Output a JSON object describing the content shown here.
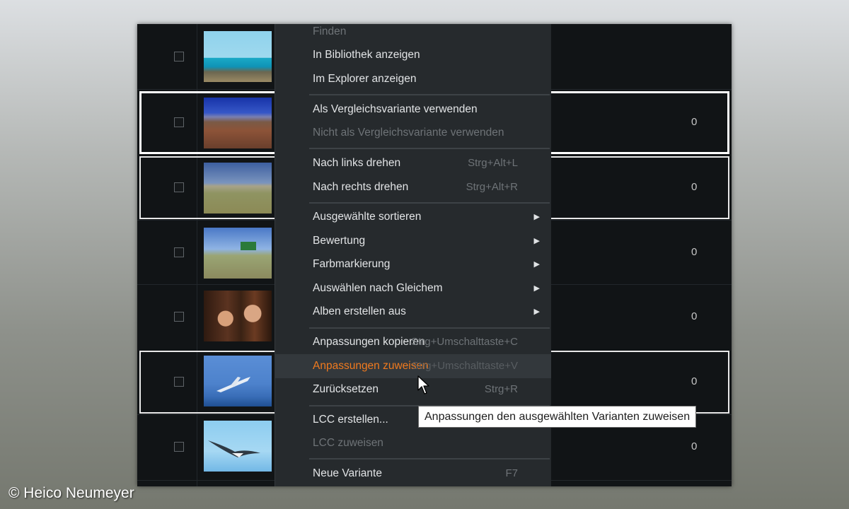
{
  "menu": {
    "items": [
      {
        "label": "Finden",
        "shortcut": "",
        "enabled": false
      },
      {
        "label": "In Bibliothek anzeigen",
        "shortcut": "",
        "enabled": true
      },
      {
        "label": "Im Explorer anzeigen",
        "shortcut": "",
        "enabled": true
      },
      {
        "label": "Als Vergleichsvariante verwenden",
        "shortcut": "",
        "enabled": true
      },
      {
        "label": "Nicht als Vergleichsvariante verwenden",
        "shortcut": "",
        "enabled": false
      },
      {
        "label": "Nach links drehen",
        "shortcut": "Strg+Alt+L",
        "enabled": true
      },
      {
        "label": "Nach rechts drehen",
        "shortcut": "Strg+Alt+R",
        "enabled": true
      },
      {
        "label": "Ausgewählte sortieren",
        "shortcut": "",
        "enabled": true,
        "submenu": true
      },
      {
        "label": "Bewertung",
        "shortcut": "",
        "enabled": true,
        "submenu": true
      },
      {
        "label": "Farbmarkierung",
        "shortcut": "",
        "enabled": true,
        "submenu": true
      },
      {
        "label": "Auswählen nach Gleichem",
        "shortcut": "",
        "enabled": true,
        "submenu": true
      },
      {
        "label": "Alben erstellen aus",
        "shortcut": "",
        "enabled": true,
        "submenu": true
      },
      {
        "label": "Anpassungen kopieren",
        "shortcut": "Strg+Umschalttaste+C",
        "enabled": true
      },
      {
        "label": "Anpassungen zuweisen",
        "shortcut": "Strg+Umschalttaste+V",
        "enabled": true,
        "highlighted": true
      },
      {
        "label": "Zurücksetzen",
        "shortcut": "Strg+R",
        "enabled": true
      },
      {
        "label": "LCC erstellen...",
        "shortcut": "",
        "enabled": true
      },
      {
        "label": "LCC zuweisen",
        "shortcut": "",
        "enabled": false
      },
      {
        "label": "Neue Variante",
        "shortcut": "F7",
        "enabled": true
      }
    ],
    "submenu_arrow": "▶",
    "highlight_color": "#f07a1e"
  },
  "tooltip": {
    "text": "Anpassungen den ausgewählten Varianten zuweisen"
  },
  "browser": {
    "rows": [
      {
        "thumb": "beach-people",
        "selected": false,
        "edge": ""
      },
      {
        "thumb": "desert-road",
        "selected": true,
        "edge": "0"
      },
      {
        "thumb": "field-road",
        "selected": true,
        "edge": "0"
      },
      {
        "thumb": "field-sign",
        "selected": false,
        "edge": "0"
      },
      {
        "thumb": "two-women",
        "selected": false,
        "edge": "0"
      },
      {
        "thumb": "airplane-sky",
        "selected": true,
        "edge": "0"
      },
      {
        "thumb": "seagull-sky",
        "selected": false,
        "edge": "0"
      }
    ]
  },
  "credit": "© Heico Neumeyer"
}
